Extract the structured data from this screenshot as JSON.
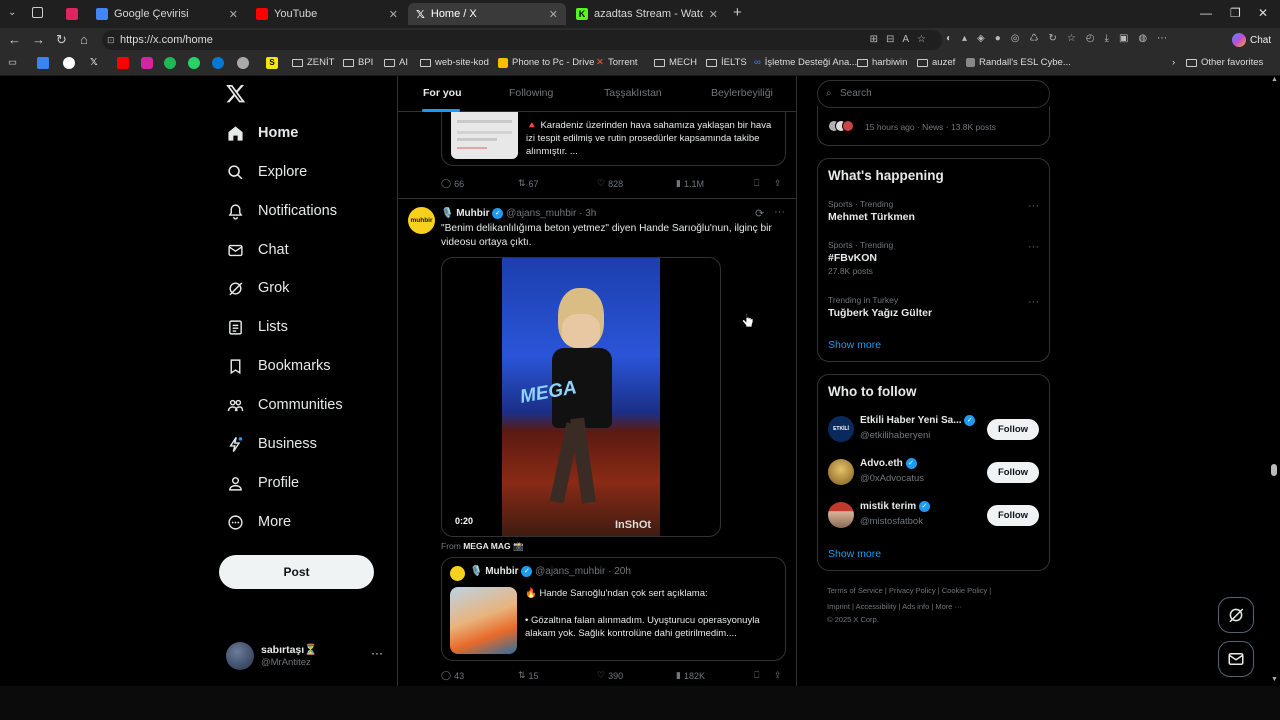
{
  "browser": {
    "tabs": [
      {
        "title": "",
        "color": "#e0245e"
      },
      {
        "title": "Google Çevirisi",
        "color": "#4285f4"
      },
      {
        "title": "YouTube",
        "color": "#ff0000"
      },
      {
        "title": "Home / X",
        "color": "#ffffff"
      },
      {
        "title": "azadtas Stream - Watch Live on K",
        "color": "#53fc18"
      }
    ],
    "url": "https://x.com/home",
    "bookmarks": [
      "ZENİT",
      "BPI",
      "AI",
      "web-site-kod",
      "Phone to Pc - Drive",
      "Torrent",
      "MECH",
      "İELTS",
      "İşletme Desteği Ana...",
      "harbiwin",
      "auzef",
      "Randall's ESL Cybe...",
      "Other favorites"
    ],
    "chat_label": "Chat"
  },
  "nav": {
    "items": [
      {
        "label": "Home",
        "icon": "home-icon"
      },
      {
        "label": "Explore",
        "icon": "search-icon"
      },
      {
        "label": "Notifications",
        "icon": "bell-icon"
      },
      {
        "label": "Chat",
        "icon": "mail-icon"
      },
      {
        "label": "Grok",
        "icon": "grok-icon"
      },
      {
        "label": "Lists",
        "icon": "list-icon"
      },
      {
        "label": "Bookmarks",
        "icon": "bookmark-icon"
      },
      {
        "label": "Communities",
        "icon": "people-icon"
      },
      {
        "label": "Business",
        "icon": "lightning-icon"
      },
      {
        "label": "Profile",
        "icon": "person-icon"
      },
      {
        "label": "More",
        "icon": "more-circle-icon"
      }
    ],
    "post_label": "Post",
    "account": {
      "name": "sabırtaşı⏳",
      "handle": "@MrAntitez"
    }
  },
  "timeline": {
    "tabs": [
      "For you",
      "Following",
      "Taşşaklıstan",
      "Beylerbeyiliği"
    ],
    "tweet1": {
      "text": "🔺 Karadeniz üzerinden hava sahamıza yaklaşan bir hava izi tespit edilmiş ve rutin prosedürler kapsamında takibe alınmıştır. ...",
      "replies": "66",
      "reposts": "67",
      "likes": "828",
      "views": "1.1M"
    },
    "tweet2": {
      "name": "🎙️ Muhbir",
      "handle": "@ajans_muhbir",
      "time": "· 3h",
      "avatar_text": "muhbir",
      "text": "\"Benim delikanlılığıma beton yetmez\" diyen Hande Sarıoğlu'nun, ilginç bir videosu ortaya çıktı.",
      "video_duration": "0:20",
      "video_watermark": "InShOt",
      "video_logo": "MEGA",
      "from_label": "From",
      "from_source": "MEGA MAG 📸",
      "quote": {
        "name": "🎙️ Muhbir",
        "handle": "@ajans_muhbir",
        "time": "· 20h",
        "headline": "🔥 Hande Sarıoğlu'ndan çok sert açıklama:",
        "body": "• Gözaltına falan alınmadım. Uyuşturucu operasyonuyla alakam yok. Sağlık kontrolüne dahi getirilmedim...."
      },
      "replies": "43",
      "reposts": "15",
      "likes": "390",
      "views": "182K"
    }
  },
  "sidebar": {
    "search_placeholder": "Search",
    "top_news": {
      "meta": "15 hours ago · News · 13.8K posts"
    },
    "happening": {
      "title": "What's happening",
      "trends": [
        {
          "meta": "Sports · Trending",
          "name": "Mehmet Türkmen",
          "posts": ""
        },
        {
          "meta": "Sports · Trending",
          "name": "#FBvKON",
          "posts": "27.8K posts"
        },
        {
          "meta": "Trending in Turkey",
          "name": "Tuğberk Yağız Gülter",
          "posts": ""
        }
      ],
      "show_more": "Show more"
    },
    "who_to_follow": {
      "title": "Who to follow",
      "users": [
        {
          "name": "Etkili Haber Yeni Sa...",
          "handle": "@etkilihaberyeni"
        },
        {
          "name": "Advo.eth",
          "handle": "@0xAdvocatus"
        },
        {
          "name": "mistik terim",
          "handle": "@mistosfatbok"
        }
      ],
      "follow_label": "Follow",
      "show_more": "Show more"
    },
    "footer": {
      "line1": "Terms of Service  |  Privacy Policy  |  Cookie Policy  |",
      "line2": "Imprint  |  Accessibility  |  Ads info  |  More ···",
      "line3": "© 2025 X Corp."
    }
  }
}
